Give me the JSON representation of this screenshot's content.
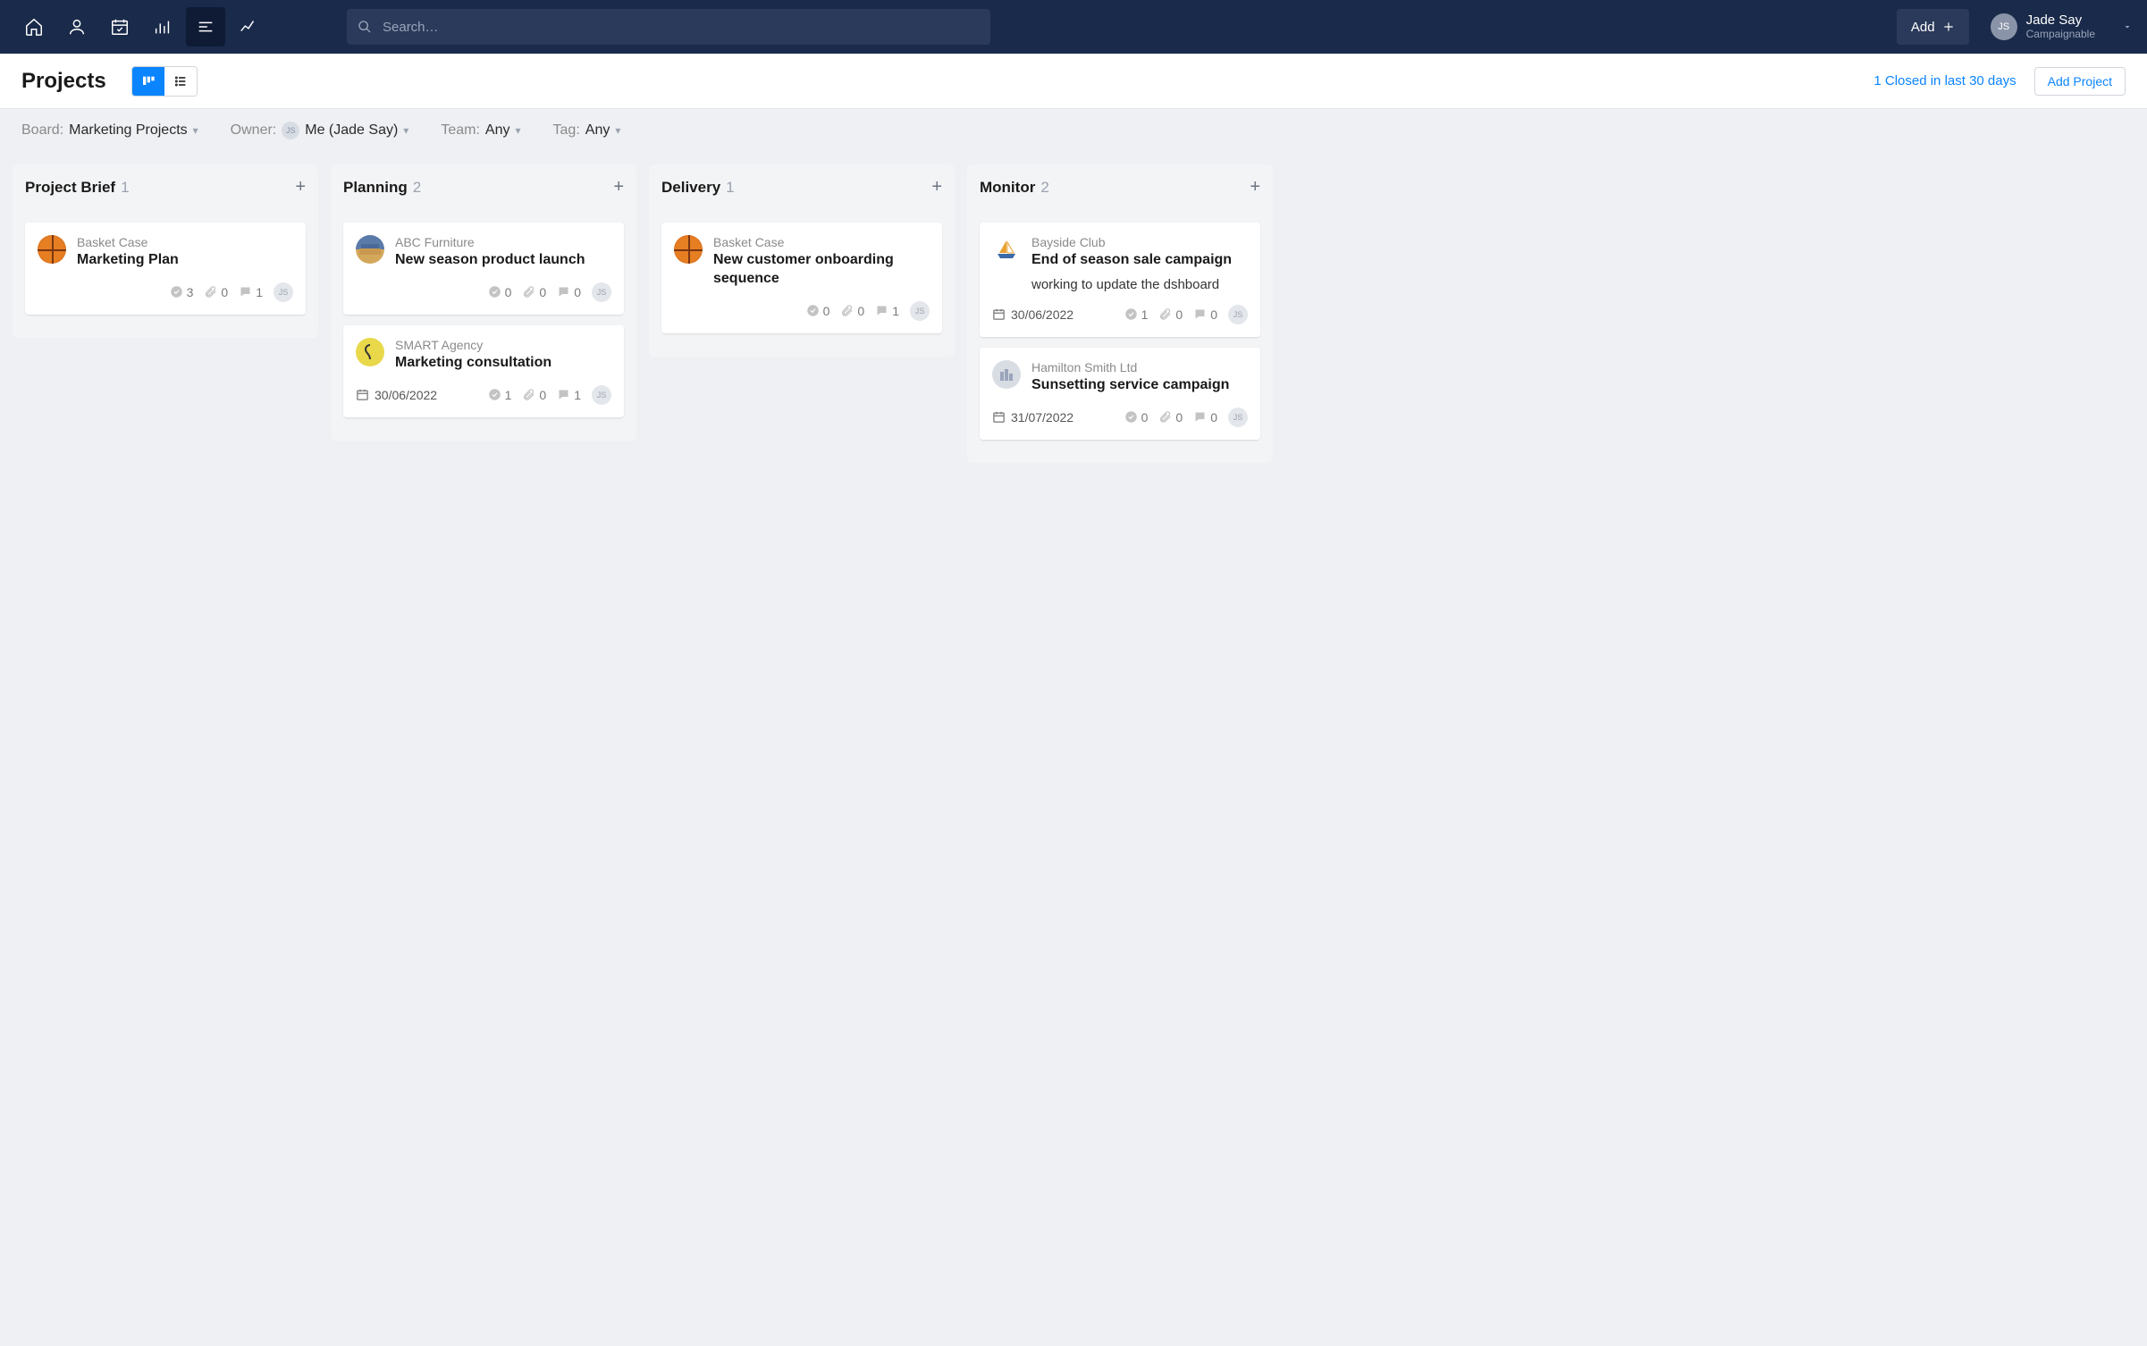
{
  "topnav": {
    "search_placeholder": "Search…",
    "add_label": "Add",
    "user": {
      "initials": "JS",
      "name": "Jade Say",
      "org": "Campaignable"
    }
  },
  "header": {
    "title": "Projects",
    "closed_text": "1 Closed in last 30 days",
    "add_project_label": "Add Project"
  },
  "filters": {
    "board_label": "Board:",
    "board_value": "Marketing Projects",
    "owner_label": "Owner:",
    "owner_initials": "JS",
    "owner_value": "Me (Jade Say)",
    "team_label": "Team:",
    "team_value": "Any",
    "tag_label": "Tag:",
    "tag_value": "Any"
  },
  "columns": [
    {
      "title": "Project Brief",
      "count": "1",
      "cards": [
        {
          "icon": "basketball",
          "client": "Basket Case",
          "title": "Marketing Plan",
          "note": "",
          "date": "",
          "checks": "3",
          "attachments": "0",
          "comments": "1",
          "assignee": "JS"
        }
      ]
    },
    {
      "title": "Planning",
      "count": "2",
      "cards": [
        {
          "icon": "sofa",
          "client": "ABC Furniture",
          "title": "New season product launch",
          "note": "",
          "date": "",
          "checks": "0",
          "attachments": "0",
          "comments": "0",
          "assignee": "JS"
        },
        {
          "icon": "smart",
          "client": "SMART Agency",
          "title": "Marketing consultation",
          "note": "",
          "date": "30/06/2022",
          "checks": "1",
          "attachments": "0",
          "comments": "1",
          "assignee": "JS"
        }
      ]
    },
    {
      "title": "Delivery",
      "count": "1",
      "cards": [
        {
          "icon": "basketball",
          "client": "Basket Case",
          "title": "New customer onboarding sequence",
          "note": "",
          "date": "",
          "checks": "0",
          "attachments": "0",
          "comments": "1",
          "assignee": "JS"
        }
      ]
    },
    {
      "title": "Monitor",
      "count": "2",
      "cards": [
        {
          "icon": "boat",
          "client": "Bayside Club",
          "title": "End of season sale campaign",
          "note": "working to update the dshboard",
          "date": "30/06/2022",
          "checks": "1",
          "attachments": "0",
          "comments": "0",
          "assignee": "JS"
        },
        {
          "icon": "hamilton",
          "client": "Hamilton Smith Ltd",
          "title": "Sunsetting service campaign",
          "note": "",
          "date": "31/07/2022",
          "checks": "0",
          "attachments": "0",
          "comments": "0",
          "assignee": "JS"
        }
      ]
    }
  ]
}
